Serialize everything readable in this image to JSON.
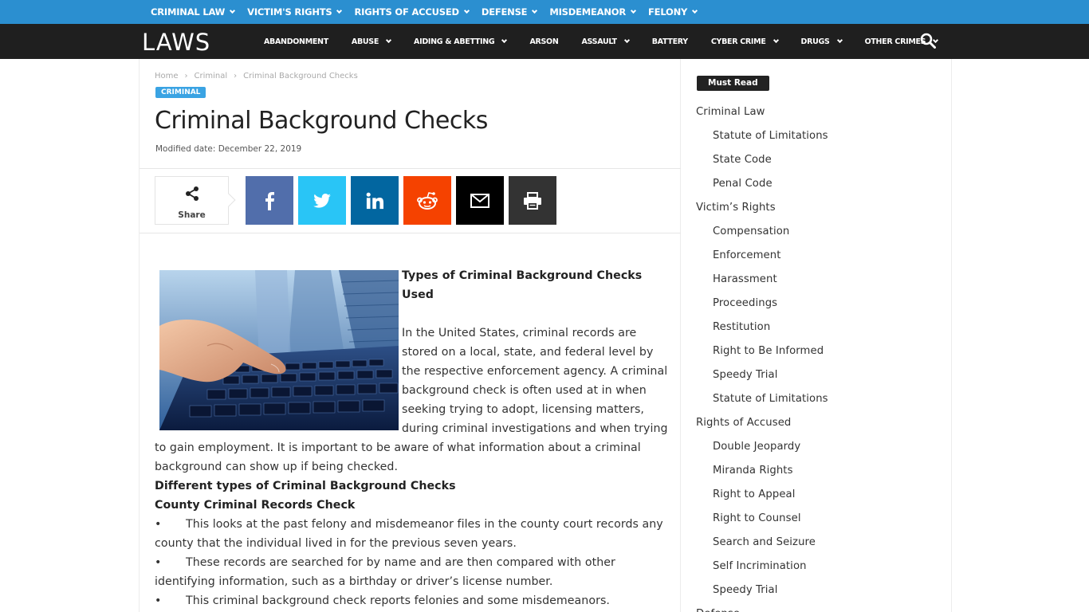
{
  "topbar": {
    "items": [
      {
        "label": "CRIMINAL LAW"
      },
      {
        "label": "VICTIM'S RIGHTS"
      },
      {
        "label": "RIGHTS OF ACCUSED"
      },
      {
        "label": "DEFENSE"
      },
      {
        "label": "MISDEMEANOR"
      },
      {
        "label": "FELONY"
      }
    ]
  },
  "mainnav": {
    "logo": "LAWS",
    "items": [
      {
        "label": "ABANDONMENT",
        "dropdown": false
      },
      {
        "label": "ABUSE",
        "dropdown": true
      },
      {
        "label": "AIDING & ABETTING",
        "dropdown": true
      },
      {
        "label": "ARSON",
        "dropdown": false
      },
      {
        "label": "ASSAULT",
        "dropdown": true
      },
      {
        "label": "BATTERY",
        "dropdown": false
      },
      {
        "label": "CYBER CRIME",
        "dropdown": true
      },
      {
        "label": "DRUGS",
        "dropdown": true
      },
      {
        "label": "OTHER CRIMES",
        "dropdown": true
      }
    ],
    "search_icon": "search-icon"
  },
  "breadcrumb": {
    "home": "Home",
    "section": "Criminal",
    "current": "Criminal Background Checks",
    "separator": "›"
  },
  "article": {
    "category": "CRIMINAL",
    "title": "Criminal Background Checks",
    "modified": "Modified date: December 22, 2019",
    "share_label": "Share",
    "share_buttons": [
      {
        "name": "facebook",
        "color": "#516eab"
      },
      {
        "name": "twitter",
        "color": "#29c5f6"
      },
      {
        "name": "linkedin",
        "color": "#0266a0"
      },
      {
        "name": "reddit",
        "color": "#f54200"
      },
      {
        "name": "email",
        "color": "#000000"
      },
      {
        "name": "print",
        "color": "#333333"
      }
    ],
    "heading1_line1": "Types of Criminal Background Checks",
    "heading1_line2": "Used",
    "para_lines": [
      "In the United States, criminal records are",
      "stored on a local, state, and federal level by",
      "the respective enforcement agency. A criminal",
      "background check is often used at in when",
      "seeking trying to adopt, licensing matters,",
      "during criminal investigations and when trying"
    ],
    "para_cont_lines": [
      "to gain employment. It is important to be aware of what information about a criminal",
      "background can show up if being checked."
    ],
    "heading2": "Different types of Criminal Background Checks",
    "heading3": "County Criminal Records Check",
    "bullet_char": "•",
    "bullets": [
      {
        "line1": "This looks at the past felony and misdemeanor files in the county court records any",
        "line2": "county that the individual lived in for the previous seven years."
      },
      {
        "line1": "These records are searched for by name and are then compared with other",
        "line2": "identifying information, such as a birthday or driver’s license number."
      },
      {
        "line1": "This criminal background check reports felonies and some misdemeanors.",
        "line2": ""
      }
    ]
  },
  "sidebar": {
    "badge": "Must Read",
    "items": [
      {
        "label": "Criminal Law",
        "level": 0
      },
      {
        "label": "Statute of Limitations",
        "level": 1
      },
      {
        "label": "State Code",
        "level": 1
      },
      {
        "label": "Penal Code",
        "level": 1
      },
      {
        "label": "Victim’s Rights",
        "level": 0
      },
      {
        "label": "Compensation",
        "level": 1
      },
      {
        "label": "Enforcement",
        "level": 1
      },
      {
        "label": "Harassment",
        "level": 1
      },
      {
        "label": "Proceedings",
        "level": 1
      },
      {
        "label": "Restitution",
        "level": 1
      },
      {
        "label": "Right to Be Informed",
        "level": 1
      },
      {
        "label": "Speedy Trial",
        "level": 1
      },
      {
        "label": "Statute of Limitations",
        "level": 1
      },
      {
        "label": "Rights of Accused",
        "level": 0
      },
      {
        "label": "Double Jeopardy",
        "level": 1
      },
      {
        "label": "Miranda Rights",
        "level": 1
      },
      {
        "label": "Right to Appeal",
        "level": 1
      },
      {
        "label": "Right to Counsel",
        "level": 1
      },
      {
        "label": "Search and Seizure",
        "level": 1
      },
      {
        "label": "Self Incrimination",
        "level": 1
      },
      {
        "label": "Speedy Trial",
        "level": 1
      },
      {
        "label": "Defense",
        "level": 0
      }
    ]
  }
}
